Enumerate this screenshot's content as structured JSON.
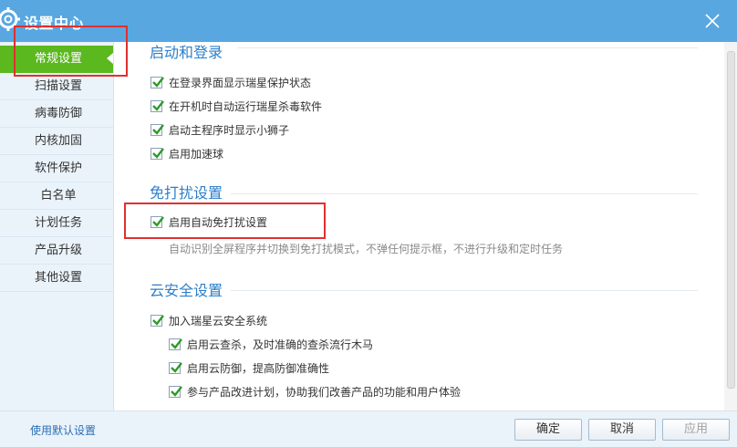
{
  "window": {
    "title": "设置中心",
    "colors": {
      "titlebar": "#59a7e0",
      "active_nav": "#5bb81f",
      "section_title": "#2c7fc9",
      "highlight": "#e03030"
    }
  },
  "sidebar": {
    "items": [
      {
        "label": "常规设置",
        "active": true
      },
      {
        "label": "扫描设置",
        "active": false
      },
      {
        "label": "病毒防御",
        "active": false
      },
      {
        "label": "内核加固",
        "active": false
      },
      {
        "label": "软件保护",
        "active": false
      },
      {
        "label": "白名单",
        "active": false
      },
      {
        "label": "计划任务",
        "active": false
      },
      {
        "label": "产品升级",
        "active": false
      },
      {
        "label": "其他设置",
        "active": false
      }
    ]
  },
  "sections": {
    "startup": {
      "title": "启动和登录",
      "options": [
        {
          "label": "在登录界面显示瑞星保护状态",
          "checked": true
        },
        {
          "label": "在开机时自动运行瑞星杀毒软件",
          "checked": true
        },
        {
          "label": "启动主程序时显示小狮子",
          "checked": true
        },
        {
          "label": "启用加速球",
          "checked": true
        }
      ]
    },
    "dnd": {
      "title": "免打扰设置",
      "options": [
        {
          "label": "启用自动免打扰设置",
          "checked": true
        }
      ],
      "description": "自动识别全屏程序并切换到免打扰模式，不弹任何提示框，不进行升级和定时任务"
    },
    "cloud": {
      "title": "云安全设置",
      "options": [
        {
          "label": "加入瑞星云安全系统",
          "checked": true
        },
        {
          "label": "启用云查杀，及时准确的查杀流行木马",
          "checked": true
        },
        {
          "label": "启用云防御，提高防御准确性",
          "checked": true
        },
        {
          "label": "参与产品改进计划，协助我们改善产品的功能和用户体验",
          "checked": true
        }
      ]
    }
  },
  "footer": {
    "default_link": "使用默认设置",
    "ok": "确定",
    "cancel": "取消",
    "apply": "应用"
  }
}
